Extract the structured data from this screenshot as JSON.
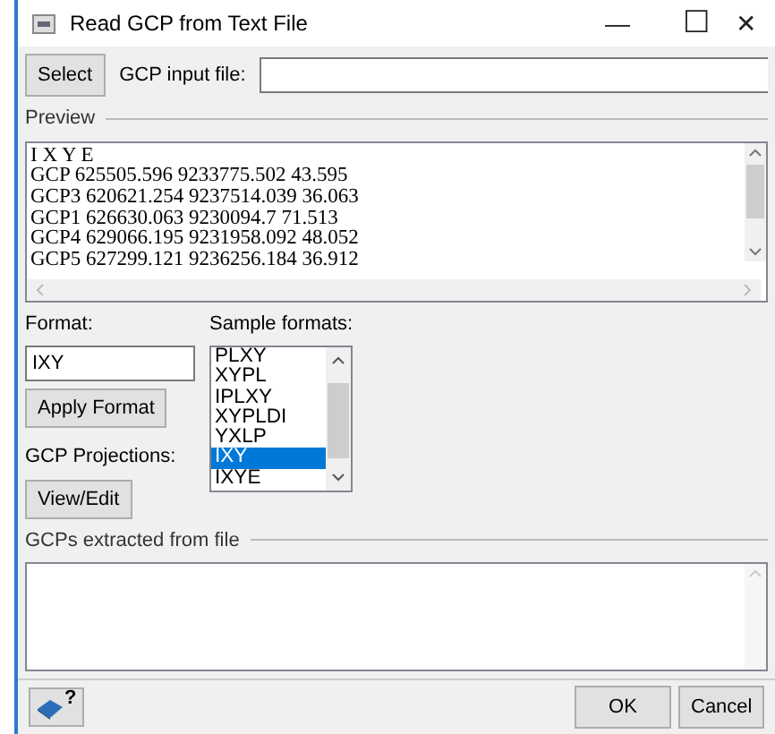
{
  "window": {
    "title": "Read GCP from Text File",
    "controls": [
      "—",
      "☐",
      "✕"
    ]
  },
  "input_row": {
    "button": "Select",
    "label": "GCP input file:"
  },
  "preview": {
    "label": "Preview",
    "lines": [
      "I X Y E",
      "GCP 625505.596 9233775.502 43.595",
      "GCP3 620621.254 9237514.039 36.063",
      "GCP1 626630.063 9230094.7 71.513",
      "GCP4 629066.195 9231958.092 48.052",
      "GCP5 627299.121 9236256.184 36.912"
    ]
  },
  "format": {
    "label": "Format:",
    "value": "IXY",
    "apply_button": "Apply Format"
  },
  "projections": {
    "label": "GCP Projections:",
    "button": "View/Edit"
  },
  "sample_formats": {
    "label": "Sample formats:",
    "items": [
      {
        "text": "PLXY",
        "selected": false
      },
      {
        "text": "XYPL",
        "selected": false
      },
      {
        "text": "IPLXY",
        "selected": false
      },
      {
        "text": "XYPLDI",
        "selected": false
      },
      {
        "text": "YXLP",
        "selected": false
      },
      {
        "text": "IXY",
        "selected": true
      },
      {
        "text": "IXYE",
        "selected": false
      }
    ]
  },
  "extracted": {
    "label": "GCPs extracted from file"
  },
  "footer": {
    "help_icon": "?",
    "buttons": [
      "OK",
      "Cancel"
    ]
  }
}
